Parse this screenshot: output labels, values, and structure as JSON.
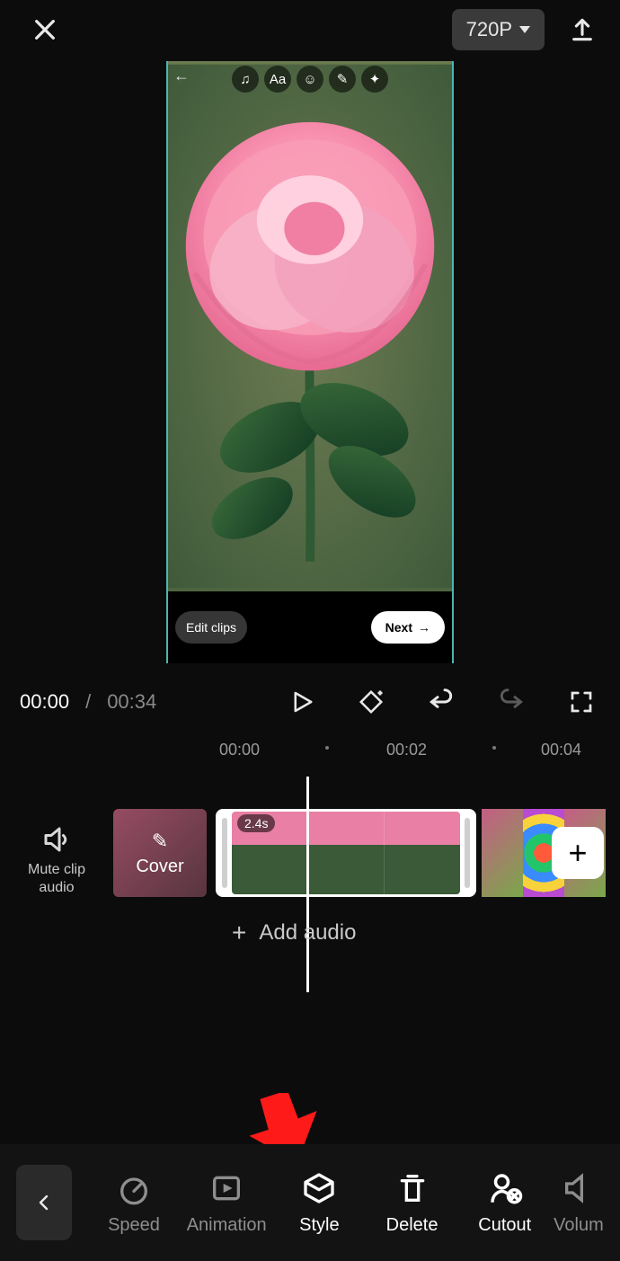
{
  "topbar": {
    "resolution": "720P"
  },
  "preview": {
    "edit_clips": "Edit clips",
    "next": "Next",
    "mini_tools": [
      "♫",
      "Aa",
      "☺",
      "✎",
      "✦"
    ]
  },
  "playback": {
    "current_time": "00:00",
    "separator": " / ",
    "total_time": "00:34"
  },
  "ruler": {
    "t0": "00:00",
    "t1": "00:02",
    "t2": "00:04"
  },
  "timeline": {
    "mute_label_l1": "Mute clip",
    "mute_label_l2": "audio",
    "cover_label": "Cover",
    "clip_duration": "2.4s",
    "add_audio": "Add audio"
  },
  "bottom_bar": {
    "items": [
      {
        "key": "speed",
        "label": "Speed",
        "active": false
      },
      {
        "key": "animation",
        "label": "Animation",
        "active": false
      },
      {
        "key": "style",
        "label": "Style",
        "active": true
      },
      {
        "key": "delete",
        "label": "Delete",
        "active": true
      },
      {
        "key": "cutout",
        "label": "Cutout",
        "active": true
      },
      {
        "key": "volume",
        "label": "Volum",
        "active": false
      }
    ]
  },
  "annotation": {
    "target": "style"
  }
}
